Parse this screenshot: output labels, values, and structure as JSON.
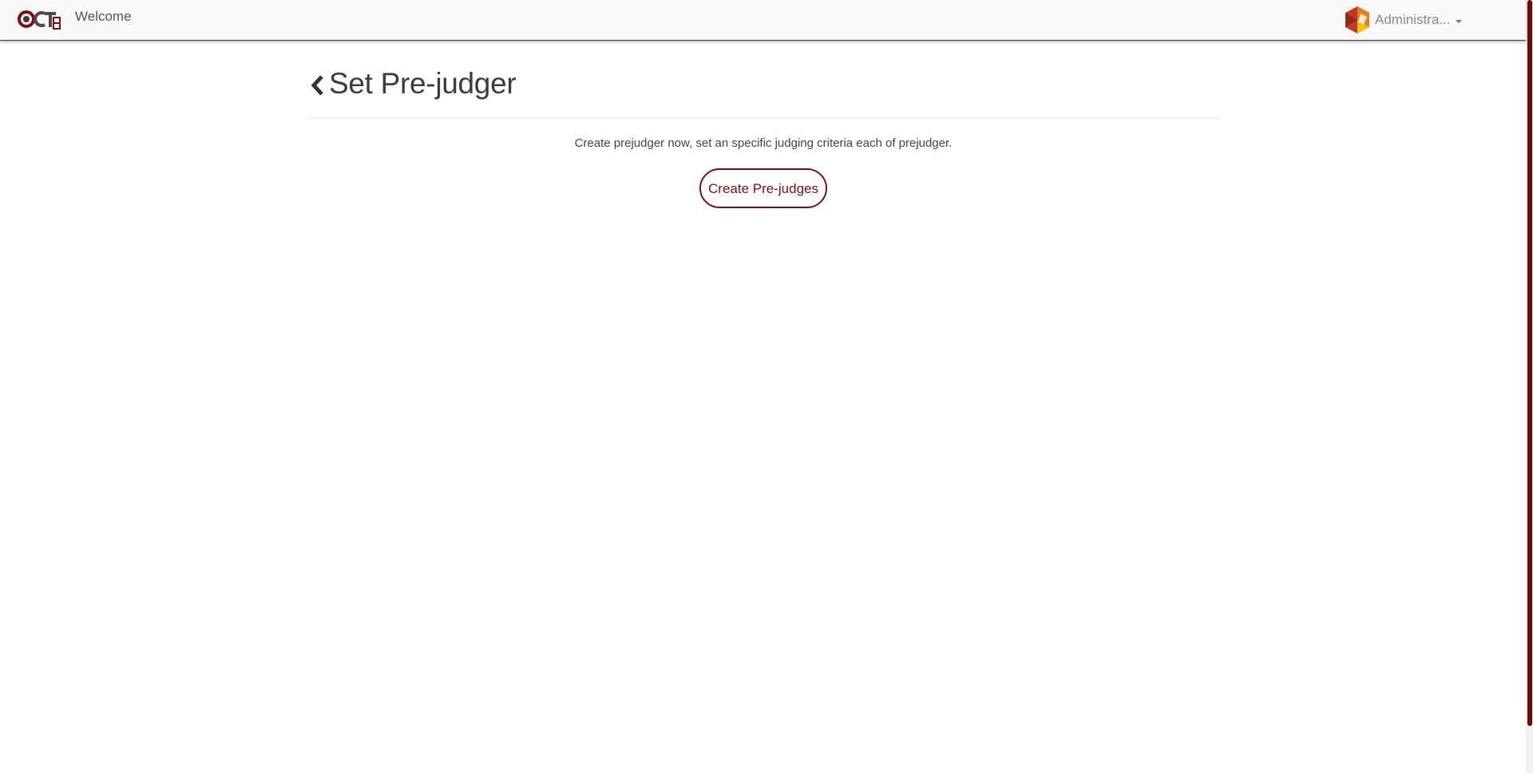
{
  "navbar": {
    "brand_logo": "OCTF8",
    "welcome_label": "Welcome",
    "user_name": "Administra...",
    "avatar_icon": "hexagon-avatar-icon",
    "caret_icon": "caret-down-icon"
  },
  "page": {
    "back_icon": "chevron-left-icon",
    "title": "Set Pre-judger",
    "description": "Create prejudger now, set an specific judging criteria each of prejudger.",
    "create_button_label": "Create Pre-judges"
  },
  "colors": {
    "accent": "#7b0f12",
    "navbar_bg": "#f8f8f8",
    "scrollbar_thumb": "#6f0a0a"
  }
}
